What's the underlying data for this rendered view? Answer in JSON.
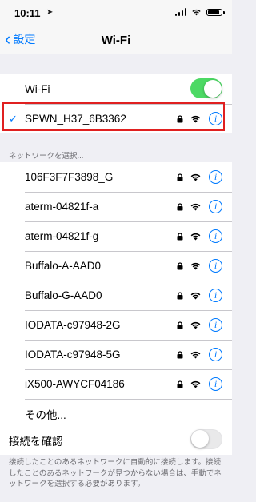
{
  "status_bar": {
    "time": "10:11"
  },
  "nav": {
    "back_label": "設定",
    "title": "Wi-Fi"
  },
  "wifi_toggle": {
    "label": "Wi-Fi",
    "on": true
  },
  "connected_network": {
    "name": "SPWN_H37_6B3362",
    "checkmark": "✓"
  },
  "networks_header": "ネットワークを選択...",
  "networks": [
    {
      "name": "106F3F7F3898_G"
    },
    {
      "name": "aterm-04821f-a"
    },
    {
      "name": "aterm-04821f-g"
    },
    {
      "name": "Buffalo-A-AAD0"
    },
    {
      "name": "Buffalo-G-AAD0"
    },
    {
      "name": "IODATA-c97948-2G"
    },
    {
      "name": "IODATA-c97948-5G"
    },
    {
      "name": "iX500-AWYCF04186"
    }
  ],
  "other_label": "その他...",
  "ask_to_join": {
    "label": "接続を確認",
    "on": false
  },
  "footer_note": "接続したことのあるネットワークに自動的に接続します。接続したことのあるネットワークが見つからない場合は、手動でネットワークを選択する必要があります。",
  "colors": {
    "accent": "#007aff",
    "toggle_on": "#4cd964",
    "highlight": "#e02020"
  },
  "icons": {
    "info": "i",
    "back": "‹"
  }
}
